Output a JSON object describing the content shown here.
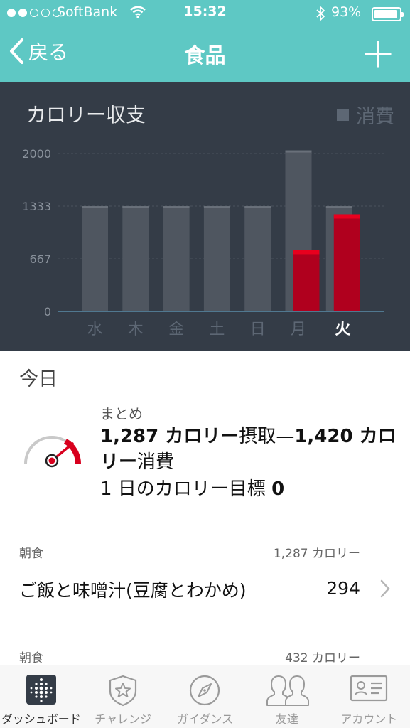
{
  "status_bar": {
    "carrier": "SoftBank",
    "time": "15:32",
    "battery": "93%",
    "battery_level": 0.93
  },
  "nav": {
    "back_label": "戻る",
    "title": "食品"
  },
  "chart_panel": {
    "title": "カロリー収支",
    "legend": "消費"
  },
  "chart_data": {
    "type": "bar",
    "title": "カロリー収支",
    "categories": [
      "水",
      "木",
      "金",
      "土",
      "日",
      "月",
      "火"
    ],
    "active_category": "火",
    "y_ticks": [
      0,
      667,
      1333,
      2000
    ],
    "ylim": [
      0,
      2000
    ],
    "grid": true,
    "legend_position": "top-right",
    "series": [
      {
        "name": "消費",
        "values": [
          1333,
          1333,
          1333,
          1333,
          1333,
          2040,
          1333
        ],
        "color": "#4f5660"
      },
      {
        "values": [
          0,
          0,
          0,
          0,
          0,
          780,
          1230
        ],
        "color": "#b0001e"
      }
    ]
  },
  "today": {
    "heading": "今日",
    "summary_label": "まとめ",
    "intake": "1,287 カロリー",
    "intake_word": "摂取",
    "dash": "—",
    "burned": "1,420 カロリー",
    "burned_word": "消費",
    "goal_label": "1 日のカロリー目標",
    "goal_value": "0",
    "gauge_color": "#d8001e"
  },
  "meals": [
    {
      "label": "朝食",
      "total": "1,287 カロリー",
      "items": [
        {
          "name": "ご飯と味噌汁(豆腐とわかめ)",
          "calories": "294"
        }
      ]
    },
    {
      "label": "朝食",
      "total": "432 カロリー"
    }
  ],
  "tabbar": [
    {
      "label": "ダッシュボード",
      "icon": "dashboard-grid-icon",
      "active": true
    },
    {
      "label": "チャレンジ",
      "icon": "star-badge-icon"
    },
    {
      "label": "ガイダンス",
      "icon": "compass-icon"
    },
    {
      "label": "友達",
      "icon": "friends-icon"
    },
    {
      "label": "アカウント",
      "icon": "account-card-icon"
    }
  ]
}
